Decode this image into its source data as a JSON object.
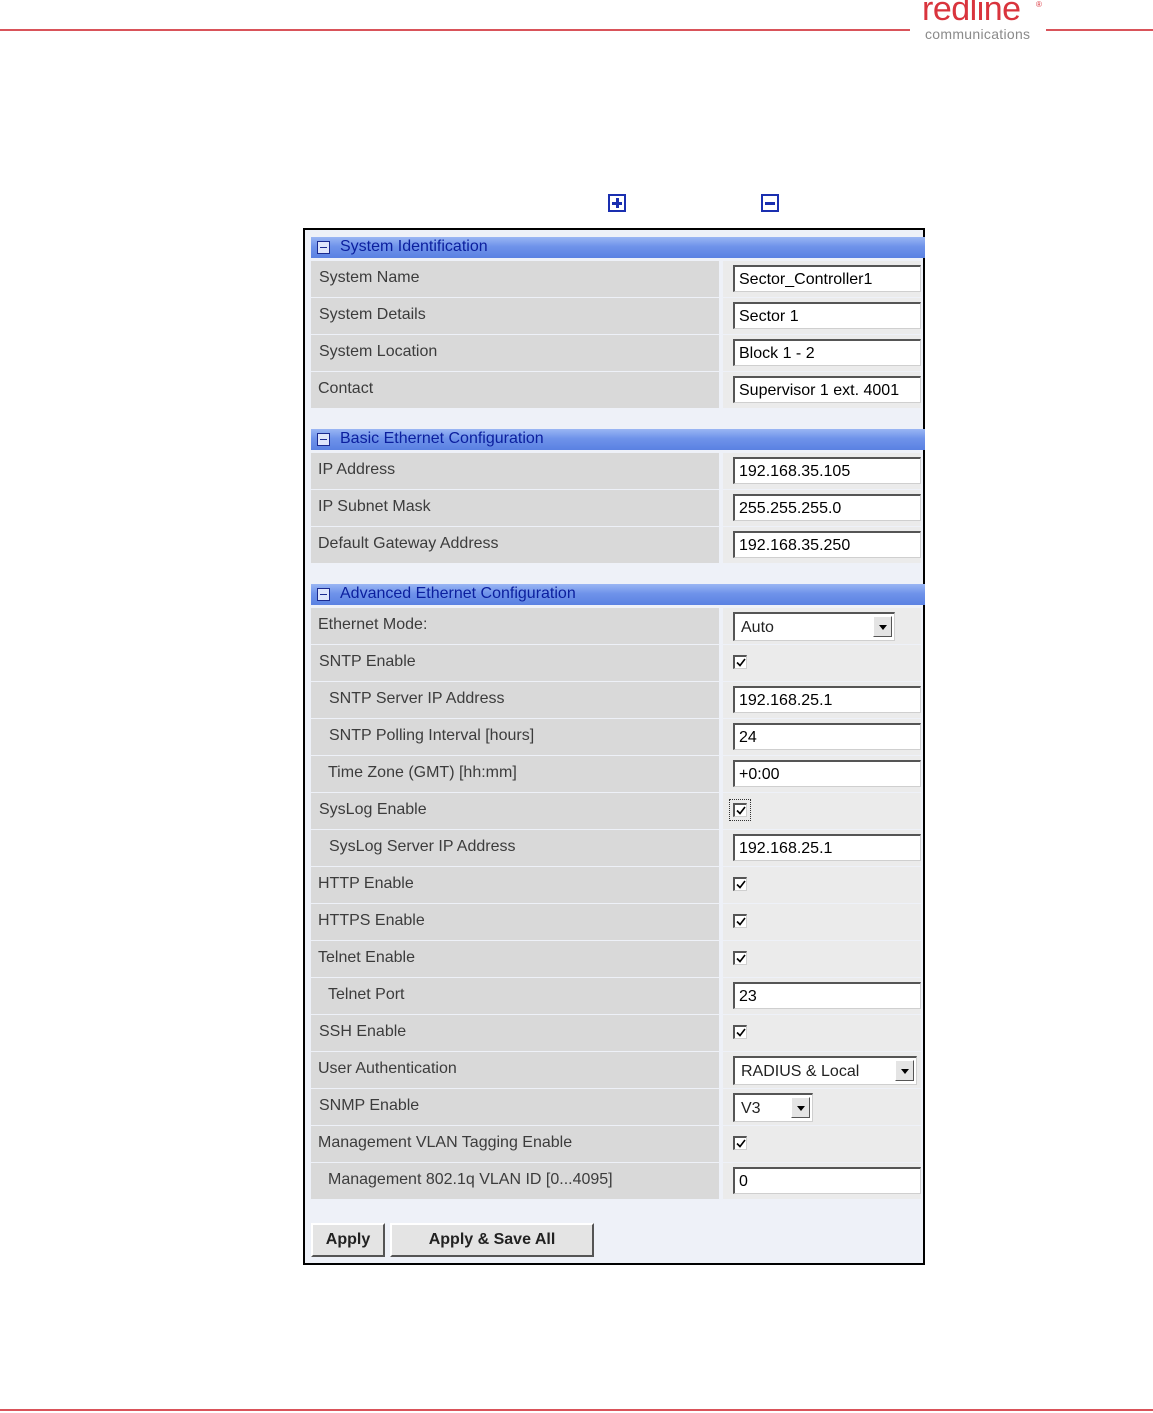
{
  "brand": {
    "name": "redline",
    "reg": "®",
    "tagline": "communications"
  },
  "toolbar": {
    "expand_icon": "plus-box-icon",
    "collapse_icon": "minus-box-icon"
  },
  "sections": [
    {
      "title": "System Identification",
      "rows": [
        {
          "label": "System Name",
          "type": "text",
          "value": "Sector_Controller1"
        },
        {
          "label": "System Details",
          "type": "text",
          "value": "Sector 1"
        },
        {
          "label": "System Location",
          "type": "text",
          "value": "Block 1 - 2"
        },
        {
          "label": "Contact",
          "type": "text",
          "value": "Supervisor 1 ext. 4001"
        }
      ]
    },
    {
      "title": "Basic Ethernet Configuration",
      "rows": [
        {
          "label": "IP Address",
          "type": "text",
          "value": "192.168.35.105"
        },
        {
          "label": "IP Subnet Mask",
          "type": "text",
          "value": "255.255.255.0"
        },
        {
          "label": "Default Gateway Address",
          "type": "text",
          "value": "192.168.35.250"
        }
      ]
    },
    {
      "title": "Advanced Ethernet Configuration",
      "rows": [
        {
          "label": "Ethernet Mode:",
          "type": "select",
          "value": "Auto"
        },
        {
          "label": "SNTP Enable",
          "type": "checkbox",
          "checked": true
        },
        {
          "label": "SNTP Server IP Address",
          "type": "text",
          "value": "192.168.25.1"
        },
        {
          "label": "SNTP Polling Interval [hours]",
          "type": "text",
          "value": "24"
        },
        {
          "label": "Time Zone (GMT) [hh:mm]",
          "type": "text",
          "value": "+0:00"
        },
        {
          "label": "SysLog Enable",
          "type": "checkbox",
          "checked": true
        },
        {
          "label": "SysLog Server IP Address",
          "type": "text",
          "value": "192.168.25.1"
        },
        {
          "label": "HTTP Enable",
          "type": "checkbox",
          "checked": true
        },
        {
          "label": "HTTPS Enable",
          "type": "checkbox",
          "checked": true
        },
        {
          "label": "Telnet Enable",
          "type": "checkbox",
          "checked": true
        },
        {
          "label": "Telnet Port",
          "type": "text",
          "value": "23"
        },
        {
          "label": "SSH Enable",
          "type": "checkbox",
          "checked": true
        },
        {
          "label": "User Authentication",
          "type": "select",
          "value": "RADIUS & Local"
        },
        {
          "label": "SNMP Enable",
          "type": "select",
          "value": "V3"
        },
        {
          "label": "Management VLAN Tagging Enable",
          "type": "checkbox",
          "checked": true
        },
        {
          "label": "Management 802.1q VLAN ID [0...4095]",
          "type": "text",
          "value": "0"
        }
      ]
    }
  ],
  "buttons": {
    "apply": "Apply",
    "apply_save": "Apply & Save All"
  },
  "colors": {
    "accent": "#d9343d",
    "header": "#6f93ea",
    "header_text": "#0b1f9e"
  }
}
